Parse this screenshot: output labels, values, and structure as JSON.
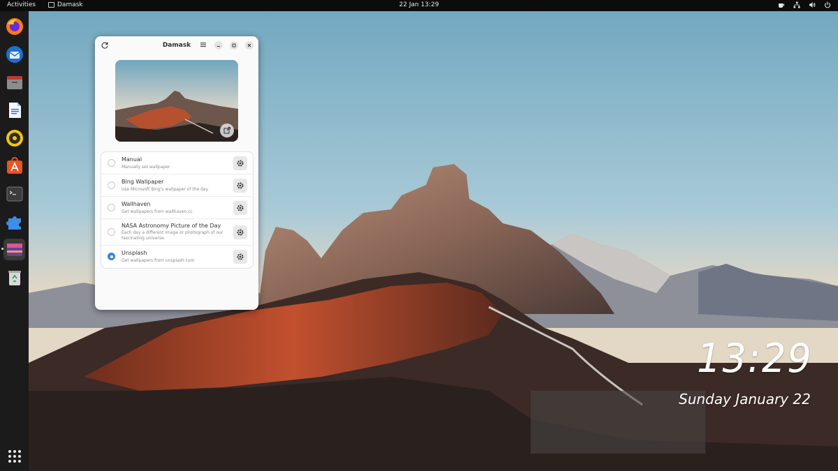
{
  "topbar": {
    "activities": "Activities",
    "app_name": "Damask",
    "datetime": "22 Jan  13:29",
    "tray_icons": [
      "coffee-icon",
      "network-icon",
      "volume-icon",
      "power-icon"
    ]
  },
  "dock": {
    "items": [
      {
        "name": "firefox",
        "icon": "firefox-icon"
      },
      {
        "name": "thunderbird",
        "icon": "thunderbird-icon"
      },
      {
        "name": "files",
        "icon": "files-icon"
      },
      {
        "name": "writer",
        "icon": "libreoffice-writer-icon"
      },
      {
        "name": "rhythmbox",
        "icon": "rhythmbox-icon"
      },
      {
        "name": "software",
        "icon": "software-center-icon"
      },
      {
        "name": "terminal",
        "icon": "terminal-icon"
      },
      {
        "name": "extensions",
        "icon": "extensions-icon"
      },
      {
        "name": "damask",
        "icon": "damask-icon"
      },
      {
        "name": "trash",
        "icon": "trash-icon"
      }
    ],
    "apps_grid": "show-apps-icon"
  },
  "window": {
    "title": "Damask",
    "sources": [
      {
        "title": "Manual",
        "description": "Manually set wallpaper",
        "selected": false
      },
      {
        "title": "Bing Wallpaper",
        "description": "Use Microsoft Bing's wallpaper of the day",
        "selected": false
      },
      {
        "title": "Wallhaven",
        "description": "Get wallpapers from wallhaven.cc",
        "selected": false
      },
      {
        "title": "NASA Astronomy Picture of the Day",
        "description": "Each day a different image or photograph of our fascinating universe.",
        "selected": false
      },
      {
        "title": "Unsplash",
        "description": "Get wallpapers from unsplash.com",
        "selected": true
      }
    ]
  },
  "desktop_clock": {
    "time": "13:29",
    "date": "Sunday January 22"
  },
  "colors": {
    "accent": "#3584e4",
    "topbar": "#0c0c0c",
    "dock": "#1b1b1b"
  }
}
